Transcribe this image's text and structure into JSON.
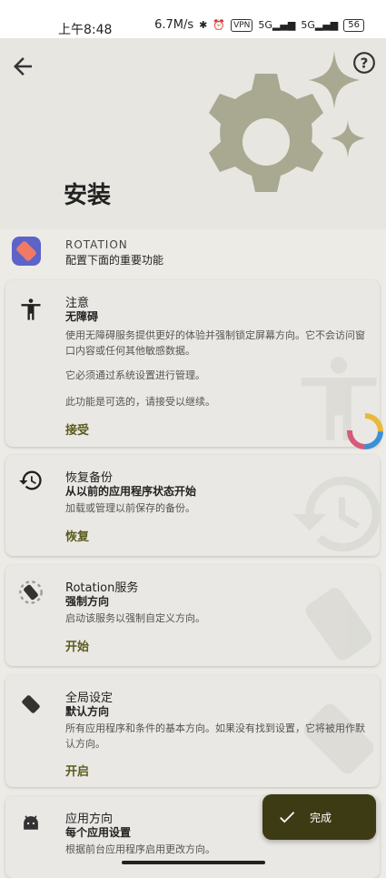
{
  "status": {
    "time": "上午8:48",
    "net_speed": "6.7M/s",
    "vpn": "VPN",
    "signal1": "5G",
    "signal2": "5G",
    "battery": "56"
  },
  "header": {
    "title": "安装"
  },
  "app": {
    "name": "ROTATION",
    "subtitle": "配置下面的重要功能"
  },
  "cards": [
    {
      "title": "注意",
      "subtitle": "无障碍",
      "desc1": "使用无障碍服务提供更好的体验并强制锁定屏幕方向。它不会访问窗口内容或任何其他敏感数据。",
      "desc2": "它必须通过系统设置进行管理。",
      "desc3": "此功能是可选的，请接受以继续。",
      "action": "接受"
    },
    {
      "title": "恢复备份",
      "subtitle": "从以前的应用程序状态开始",
      "desc": "加载或管理以前保存的备份。",
      "action": "恢复"
    },
    {
      "title": "Rotation服务",
      "subtitle": "强制方向",
      "desc": "启动该服务以强制自定义方向。",
      "action": "开始"
    },
    {
      "title": "全局设定",
      "subtitle": "默认方向",
      "desc": "所有应用程序和条件的基本方向。如果没有找到设置，它将被用作默认方向。",
      "action": "开启"
    },
    {
      "title": "应用方向",
      "subtitle": "每个应用设置",
      "desc": "根据前台应用程序启用更改方向。"
    }
  ],
  "fab": {
    "label": "完成"
  }
}
